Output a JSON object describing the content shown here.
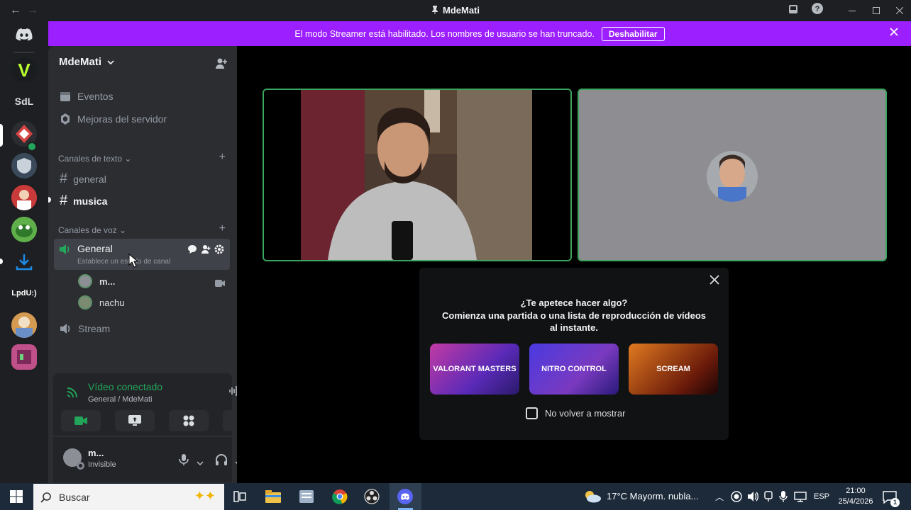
{
  "window": {
    "title": "MdeMati",
    "back": "←",
    "forward": "→"
  },
  "banner": {
    "message": "El modo Streamer está habilitado. Los nombres de usuario se han truncado.",
    "button_label": "Deshabilitar",
    "bg_color": "#9c1fff"
  },
  "rail": {
    "servers": [
      {
        "label": "V",
        "color": "#1a1d1f"
      },
      {
        "label": "SdL",
        "color": "#1e1f22"
      },
      {
        "label": "",
        "color": "#2b2d31"
      },
      {
        "label": "",
        "color": "#3b4a5a"
      },
      {
        "label": "",
        "color": "#8a2a2a"
      },
      {
        "label": "",
        "color": "#3f8f3f"
      },
      {
        "label": "",
        "color": "#1e1f22"
      },
      {
        "label": "LpdU:)",
        "color": "#1e1f22"
      },
      {
        "label": "",
        "color": "#a8743a"
      },
      {
        "label": "",
        "color": "#b0407a"
      }
    ]
  },
  "server": {
    "name": "MdeMati",
    "events": "Eventos",
    "boosts": "Mejoras del servidor"
  },
  "text_channels": {
    "category": "Canales de texto",
    "items": [
      {
        "name": "general",
        "active": false
      },
      {
        "name": "musica",
        "active": true
      }
    ]
  },
  "voice_channels": {
    "category": "Canales de voz",
    "general": {
      "name": "General",
      "status_hint": "Establece un estado de canal",
      "members": [
        {
          "name": "m..."
        },
        {
          "name": "nachu"
        }
      ]
    },
    "stream": {
      "name": "Stream"
    }
  },
  "voice_panel": {
    "status": "Vídeo conectado",
    "location": "General / MdeMati",
    "status_color": "#23a55a"
  },
  "user_panel": {
    "name": "m...",
    "status": "Invisible"
  },
  "popup": {
    "heading": "¿Te apetece hacer algo?",
    "subtitle": "Comienza una partida o una lista de reproducción de vídeos al instante.",
    "activities": [
      {
        "name": "VALORANT MASTERS"
      },
      {
        "name": "NITRO CONTROL"
      },
      {
        "name": "SCREAM"
      }
    ],
    "checkbox_label": "No volver a mostrar"
  },
  "taskbar": {
    "search_placeholder": "Buscar",
    "weather": "17°C  Mayorm. nubla...",
    "language": "ESP",
    "time": "21:00",
    "date": "25/4/2026",
    "notifications": "1"
  }
}
